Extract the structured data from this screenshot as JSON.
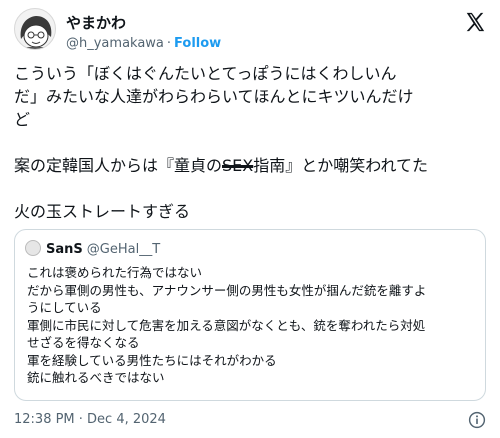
{
  "header": {
    "display_name": "やまかわ",
    "handle": "@h_yamakawa",
    "separator": "·",
    "follow_label": "Follow"
  },
  "tweet": {
    "lines": [
      "こういう「ぼくはぐんたいとてっぽうにはくわしいん",
      "だ」みたいな人達がわらわらいてほんとにキツいんだけ",
      "ど",
      "",
      "火の玉ストレートすぎる"
    ],
    "line_b_prefix": "案の定韓国人からは『童貞の",
    "line_b_struck": "SEX",
    "line_b_suffix": "指南』とか嘲笑われてた"
  },
  "quote": {
    "name": "SanS",
    "handle": "@GeHal__T",
    "lines": [
      "これは褒められた行為ではない",
      "だから軍側の男性も、アナウンサー側の男性も女性が掴んだ銃を離すよ",
      "うにしている",
      "軍側に市民に対して危害を加える意図がなくとも、銃を奪われたら対処",
      "せざるを得なくなる",
      "軍を経験している男性たちにはそれがわかる",
      "銃に触れるべきではない"
    ]
  },
  "footer": {
    "timestamp": "12:38 PM · Dec 4, 2024"
  },
  "icons": {
    "x_logo": "x-logo-icon",
    "info": "info-icon"
  },
  "colors": {
    "accent": "#1d9bf0",
    "secondary_text": "#536471",
    "border": "#cfd9de"
  }
}
